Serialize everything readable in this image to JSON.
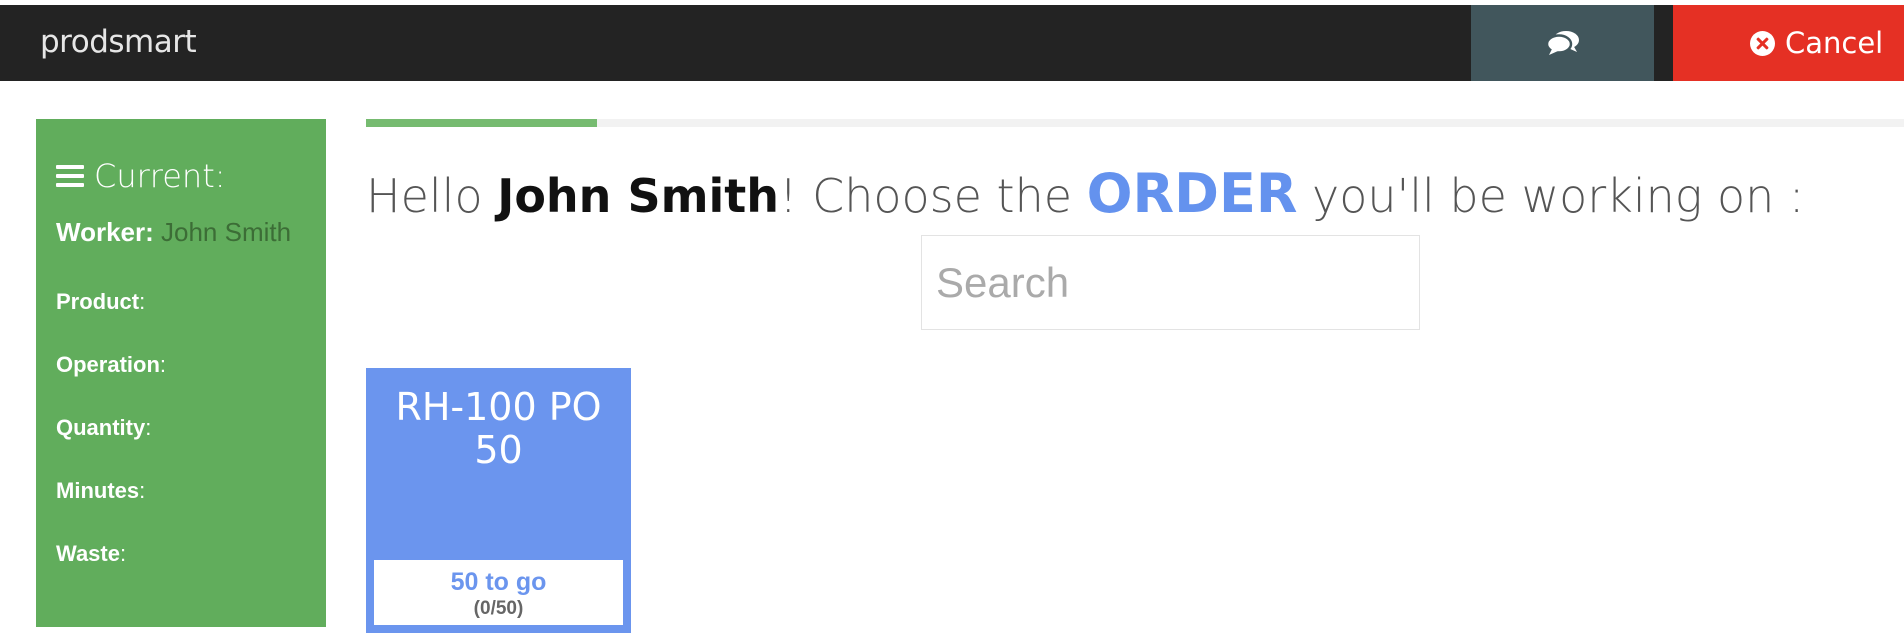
{
  "app": {
    "brand": "prodsmart"
  },
  "header": {
    "chat_icon": "comments-icon",
    "cancel_label": "Cancel",
    "cancel_icon": "times-circle-icon"
  },
  "sidebar": {
    "title": "Current:",
    "title_icon": "bars-icon",
    "worker_label": "Worker:",
    "worker_value": "John Smith",
    "fields": [
      {
        "label": "Product",
        "colon": ":"
      },
      {
        "label": "Operation",
        "colon": ":"
      },
      {
        "label": "Quantity",
        "colon": ":"
      },
      {
        "label": "Minutes",
        "colon": ":"
      },
      {
        "label": "Waste",
        "colon": ":"
      }
    ]
  },
  "progress": {
    "fraction": 0.15
  },
  "main": {
    "greeting_prefix": "Hello ",
    "user_name": "John Smith",
    "greeting_mid": "! Choose the ",
    "order_word": "ORDER",
    "greeting_suffix": " you'll be working on :",
    "search_placeholder": "Search",
    "orders": [
      {
        "title_line1": "RH-100 PO",
        "title_line2": "50",
        "to_go": "50 to go",
        "count": "(0/50)"
      }
    ]
  },
  "colors": {
    "topbar": "#232323",
    "chat_button": "#41565c",
    "cancel_button": "#e53024",
    "sidebar": "#61ad5c",
    "order_card": "#6b95ee",
    "accent": "#6492ee"
  }
}
